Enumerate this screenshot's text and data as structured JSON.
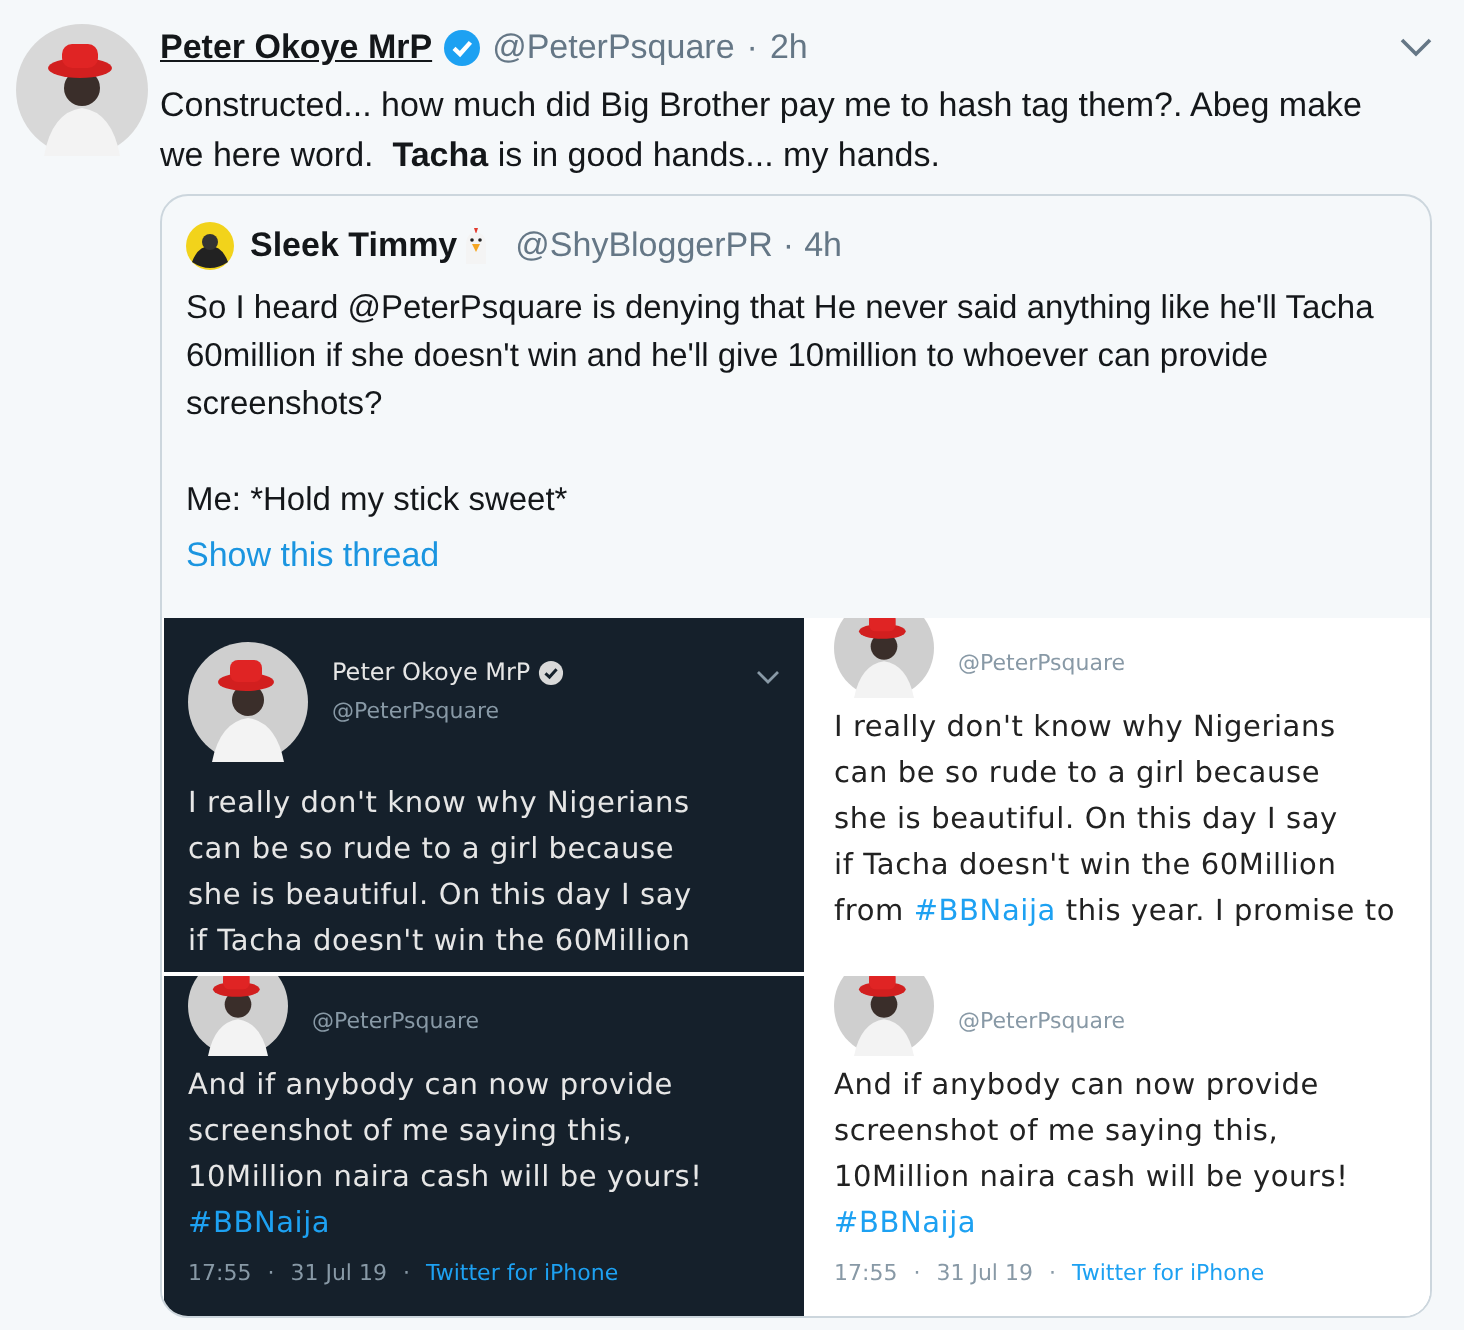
{
  "tweet": {
    "name": "Peter Okoye MrP",
    "verified": true,
    "handle": "@PeterPsquare",
    "separator": "·",
    "time": "2h",
    "text": "Constructed... how much did Big Brother pay me to hash tag them?. Abeg make we here word.  **Tacha** is in good hands... my hands."
  },
  "quoted": {
    "name": "Sleek Timmy",
    "handle": "@ShyBloggerPR",
    "separator": "·",
    "time": "4h",
    "paragraphs": [
      "So I heard @PeterPsquare is denying that He never said anything like he'll Tacha 60million if she doesn't win and he'll give 10million to whoever can provide screenshots?",
      "Me: *Hold my stick sweet*"
    ],
    "link": "Show this thread"
  },
  "images": [
    {
      "kind": "dark",
      "name": "Peter Okoye MrP",
      "verified": true,
      "handle": "@PeterPsquare",
      "lines": [
        [
          {
            "text": "I really don't know why Nigerians"
          }
        ],
        [
          {
            "text": "can be so rude to a girl because"
          }
        ],
        [
          {
            "text": "she is beautiful. On this day I say"
          }
        ],
        [
          {
            "text": "if Tacha doesn't win the 60Million"
          }
        ]
      ]
    },
    {
      "kind": "light",
      "handle": "@PeterPsquare",
      "lines": [
        [
          {
            "text": "I really don't know why Nigerians"
          }
        ],
        [
          {
            "text": "can be so rude to a girl because"
          }
        ],
        [
          {
            "text": "she is beautiful. On this day I say"
          }
        ],
        [
          {
            "text": "if Tacha doesn't win the 60Million"
          }
        ],
        [
          {
            "text": "from "
          },
          {
            "text": "#BBNaija",
            "kind": "hashtag"
          },
          {
            "text": " this year. I promise to"
          }
        ]
      ]
    },
    {
      "kind": "dark",
      "handle": "@PeterPsquare",
      "lines": [
        [
          {
            "text": "And if anybody can now provide"
          }
        ],
        [
          {
            "text": "screenshot of me saying this,"
          }
        ],
        [
          {
            "text": "10Million naira cash will be yours!"
          }
        ],
        [
          {
            "text": "#BBNaija",
            "kind": "hashtag"
          }
        ]
      ],
      "meta": {
        "time": "17:55",
        "separator": "·",
        "date": "31 Jul 19",
        "source": "Twitter for iPhone"
      }
    },
    {
      "kind": "light",
      "handle": "@PeterPsquare",
      "lines": [
        [
          {
            "text": "And if anybody can now provide"
          }
        ],
        [
          {
            "text": "screenshot of me saying this,"
          }
        ],
        [
          {
            "text": "10Million naira cash will be yours!"
          }
        ],
        [
          {
            "text": "#BBNaija",
            "kind": "hashtag"
          }
        ]
      ],
      "meta": {
        "time": "17:55",
        "separator": "·",
        "date": "31 Jul 19",
        "source": "Twitter for iPhone"
      }
    }
  ]
}
